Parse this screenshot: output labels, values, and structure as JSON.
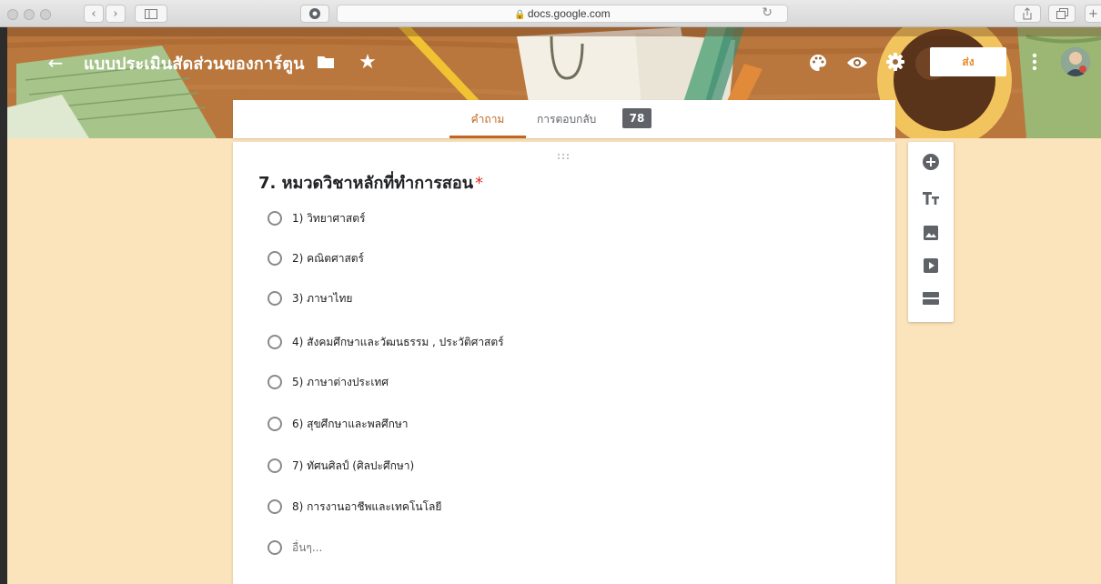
{
  "browser": {
    "address": "docs.google.com"
  },
  "header": {
    "title": "แบบประเมินสัดส่วนของการ์ตูน",
    "send_label": "ส่ง"
  },
  "tabs": {
    "questions_label": "คำถาม",
    "responses_label": "การตอบกลับ",
    "responses_count": "78"
  },
  "question": {
    "title": "7. หมวดวิชาหลักที่ทำการสอน",
    "required_mark": "*",
    "options": [
      "1) วิทยาศาสตร์",
      "2) คณิตศาสตร์",
      "3) ภาษาไทย",
      "4) สังคมศึกษาและวัฒนธรรม , ประวัติศาสตร์",
      "5) ภาษาต่างประเทศ",
      "6) สุขศึกษาและพลศึกษา",
      "7) ทัศนศิลป์ (ศิลปะศึกษา)",
      "8) การงานอาชีพและเทคโนโลยี",
      "อื่นๆ..."
    ]
  },
  "icons": {
    "back": "back-arrow-icon",
    "folder": "folder-icon",
    "star": "star-icon",
    "palette": "palette-icon",
    "preview": "eye-icon",
    "settings": "gear-icon",
    "more": "more-vert-icon",
    "add_question": "add-circle-icon",
    "add_title": "title-text-icon",
    "add_image": "image-icon",
    "add_video": "video-icon",
    "add_section": "section-icon"
  },
  "colors": {
    "accent": "#c1661f",
    "background": "#fbe3bb",
    "required": "#d93025"
  }
}
